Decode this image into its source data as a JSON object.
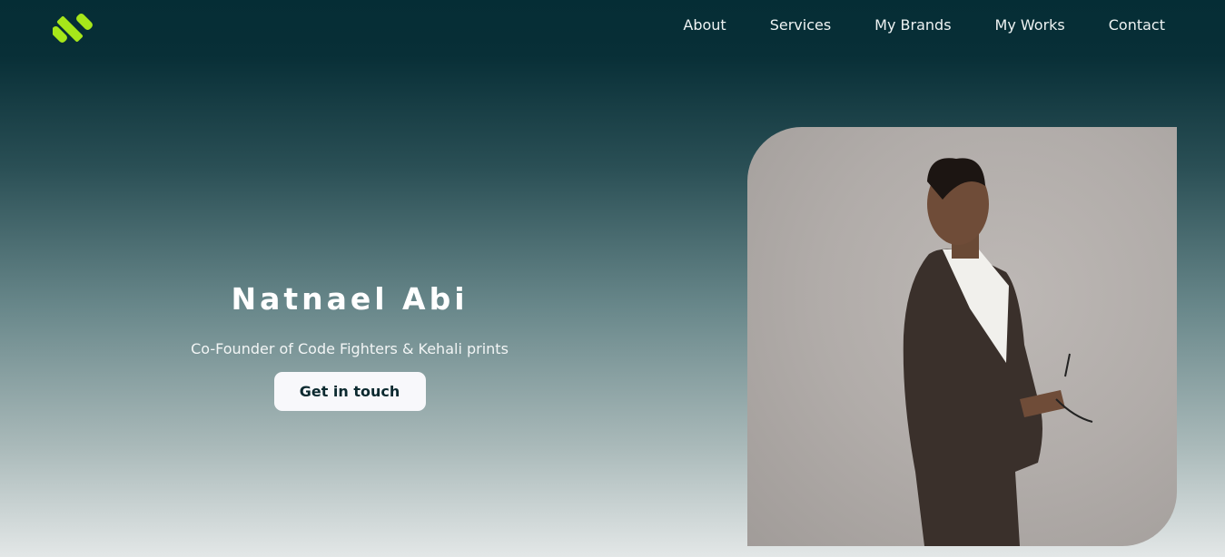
{
  "nav": {
    "items": [
      "About",
      "Services",
      "My Brands",
      "My Works",
      "Contact"
    ]
  },
  "hero": {
    "name": "Natnael Abi",
    "subtitle": "Co-Founder of Code Fighters & Kehali prints",
    "cta": "Get in touch"
  },
  "colors": {
    "brand": "#a6e61a",
    "bg_top": "#052d35",
    "button_text": "#0c2a30"
  },
  "icons": {
    "logo": "three-diagonal-bars-logo"
  }
}
